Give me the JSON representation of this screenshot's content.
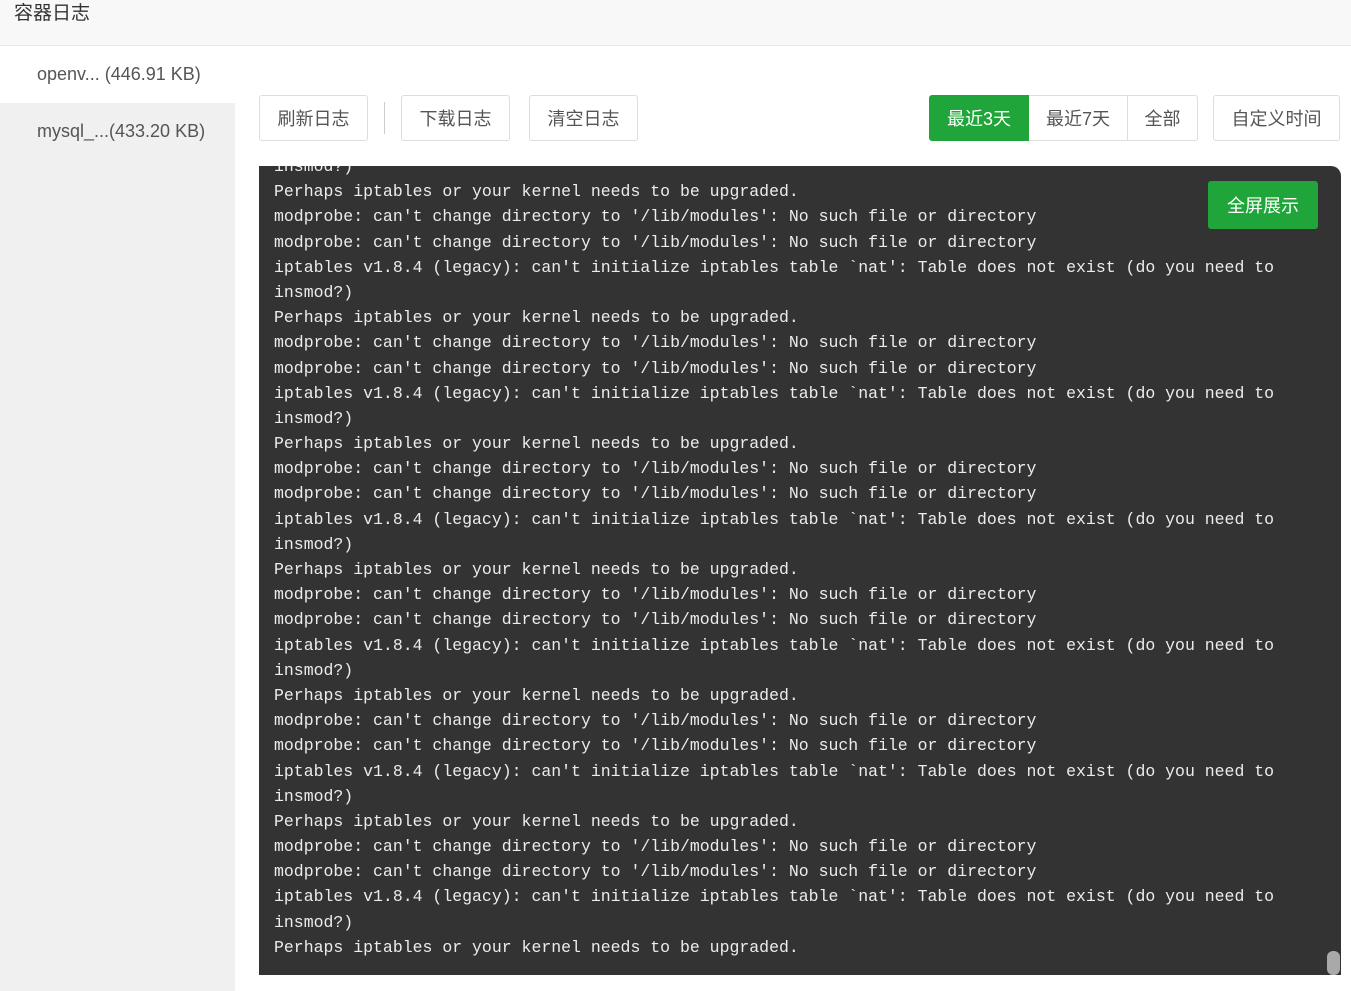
{
  "window": {
    "title": "容器日志"
  },
  "sidebar": {
    "items": [
      {
        "label": "openv... (446.91 KB)",
        "active": true
      },
      {
        "label": "mysql_...(433.20 KB)",
        "active": false
      }
    ]
  },
  "toolbar": {
    "refresh_label": "刷新日志",
    "download_label": "下载日志",
    "clear_label": "清空日志",
    "time_range": {
      "options": [
        "最近3天",
        "最近7天",
        "全部"
      ],
      "selected_index": 0
    },
    "custom_time_label": "自定义时间"
  },
  "log": {
    "fullscreen_label": "全屏展示",
    "lines": [
      "insmod?)",
      "Perhaps iptables or your kernel needs to be upgraded.",
      "modprobe: can't change directory to '/lib/modules': No such file or directory",
      "modprobe: can't change directory to '/lib/modules': No such file or directory",
      "iptables v1.8.4 (legacy): can't initialize iptables table `nat': Table does not exist (do you need to",
      "insmod?)",
      "Perhaps iptables or your kernel needs to be upgraded.",
      "modprobe: can't change directory to '/lib/modules': No such file or directory",
      "modprobe: can't change directory to '/lib/modules': No such file or directory",
      "iptables v1.8.4 (legacy): can't initialize iptables table `nat': Table does not exist (do you need to",
      "insmod?)",
      "Perhaps iptables or your kernel needs to be upgraded.",
      "modprobe: can't change directory to '/lib/modules': No such file or directory",
      "modprobe: can't change directory to '/lib/modules': No such file or directory",
      "iptables v1.8.4 (legacy): can't initialize iptables table `nat': Table does not exist (do you need to",
      "insmod?)",
      "Perhaps iptables or your kernel needs to be upgraded.",
      "modprobe: can't change directory to '/lib/modules': No such file or directory",
      "modprobe: can't change directory to '/lib/modules': No such file or directory",
      "iptables v1.8.4 (legacy): can't initialize iptables table `nat': Table does not exist (do you need to",
      "insmod?)",
      "Perhaps iptables or your kernel needs to be upgraded.",
      "modprobe: can't change directory to '/lib/modules': No such file or directory",
      "modprobe: can't change directory to '/lib/modules': No such file or directory",
      "iptables v1.8.4 (legacy): can't initialize iptables table `nat': Table does not exist (do you need to",
      "insmod?)",
      "Perhaps iptables or your kernel needs to be upgraded.",
      "modprobe: can't change directory to '/lib/modules': No such file or directory",
      "modprobe: can't change directory to '/lib/modules': No such file or directory",
      "iptables v1.8.4 (legacy): can't initialize iptables table `nat': Table does not exist (do you need to",
      "insmod?)",
      "Perhaps iptables or your kernel needs to be upgraded."
    ]
  },
  "colors": {
    "accent": "#20a53a",
    "log_background": "#333333",
    "log_text": "#ececec"
  }
}
